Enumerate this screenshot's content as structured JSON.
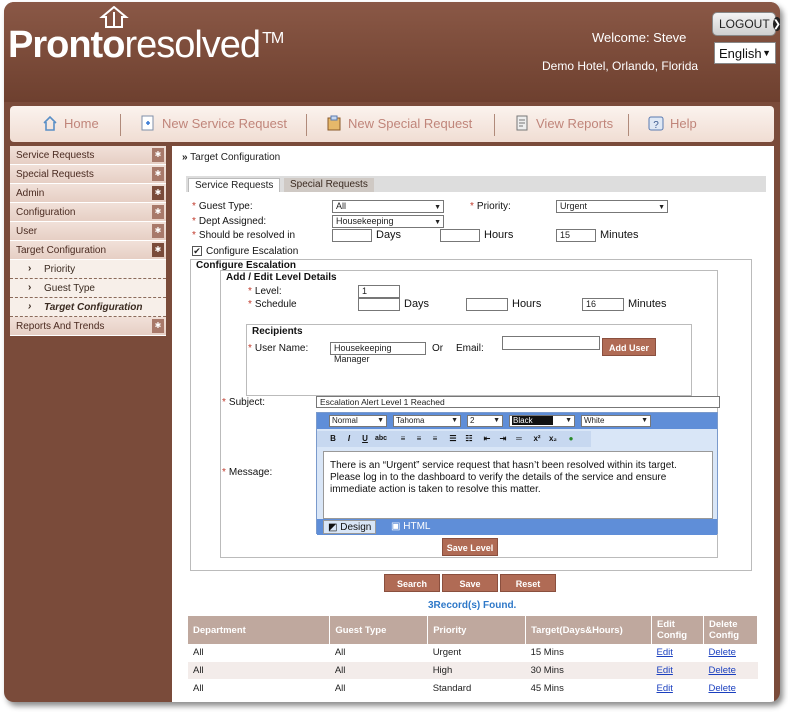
{
  "header": {
    "logo_bold": "Pronto",
    "logo_thin": "resolved",
    "logo_tm": "TM",
    "welcome": "Welcome: Steve",
    "hotel": "Demo Hotel, Orlando, Florida",
    "logout_label": "LOGOUT",
    "language": "English"
  },
  "nav": {
    "items": [
      {
        "label": "Home",
        "icon": "home-icon"
      },
      {
        "label": "New Service Request",
        "icon": "service-request-icon"
      },
      {
        "label": "New Special Request",
        "icon": "special-request-icon"
      },
      {
        "label": "View Reports",
        "icon": "reports-icon"
      },
      {
        "label": "Help",
        "icon": "help-icon"
      }
    ]
  },
  "sidebar": {
    "items": [
      {
        "label": "Service Requests"
      },
      {
        "label": "Special Requests"
      },
      {
        "label": "Admin"
      },
      {
        "label": "Configuration"
      },
      {
        "label": "User"
      },
      {
        "label": "Target Configuration"
      }
    ],
    "subitems": [
      {
        "label": "Priority"
      },
      {
        "label": "Guest Type"
      },
      {
        "label": "Target Configuration"
      }
    ],
    "last_item": "Reports And Trends"
  },
  "breadcrumb": "Target Configuration",
  "tabs": {
    "service": "Service Requests",
    "special": "Special Requests"
  },
  "form": {
    "guest_type_label": "Guest Type:",
    "guest_type_value": "All",
    "priority_label": "Priority:",
    "priority_value": "Urgent",
    "dept_label": "Dept Assigned:",
    "dept_value": "Housekeeping",
    "resolved_label": "Should be resolved in",
    "days_label": "Days",
    "hours_label": "Hours",
    "minutes_label": "Minutes",
    "days_value": "",
    "hours_value": "",
    "minutes_value": "15",
    "configure_escalation_label": "Configure Escalation",
    "configure_escalation_checked": "✔"
  },
  "escalation": {
    "title": "Configure Escalation",
    "level_title": "Add / Edit Level Details",
    "level_label": "Level:",
    "level_value": "1",
    "schedule_label": "Schedule",
    "days_label": "Days",
    "hours_label": "Hours",
    "minutes_label": "Minutes",
    "sched_days": "",
    "sched_hours": "",
    "sched_minutes": "16",
    "recipients_title": "Recipients",
    "username_label": "User Name:",
    "username_value": "Housekeeping Manager",
    "or_label": "Or",
    "email_label": "Email:",
    "email_value": "",
    "add_user_label": "Add User",
    "subject_label": "Subject:",
    "subject_value": "Escalation Alert Level 1 Reached",
    "message_label": "Message:",
    "editor": {
      "style": "Normal",
      "font": "Tahoma",
      "size": "2",
      "fore_color": "Black",
      "back_color": "White",
      "body": "There is an “Urgent” service request that hasn’t been resolved within its target. Please log in to the dashboard to verify the details of the service and ensure immediate action is taken to resolve this matter.",
      "design_tab": "Design",
      "html_tab": "HTML"
    },
    "save_level_label": "Save Level"
  },
  "actions": {
    "search": "Search",
    "save": "Save",
    "reset": "Reset"
  },
  "records_found": "3Record(s) Found.",
  "table": {
    "headers": [
      "Department",
      "Guest Type",
      "Priority",
      "Target(Days&Hours)",
      "Edit Config",
      "Delete Config"
    ],
    "rows": [
      {
        "department": "All",
        "guest_type": "All",
        "priority": "Urgent",
        "target": "15 Mins",
        "edit": "Edit",
        "delete": "Delete"
      },
      {
        "department": "All",
        "guest_type": "All",
        "priority": "High",
        "target": "30 Mins",
        "edit": "Edit",
        "delete": "Delete"
      },
      {
        "department": "All",
        "guest_type": "All",
        "priority": "Standard",
        "target": "45 Mins",
        "edit": "Edit",
        "delete": "Delete"
      }
    ]
  },
  "colors": {
    "brand": "#7a4b3a",
    "accent": "#b06b55",
    "link": "#1a3fbf"
  }
}
